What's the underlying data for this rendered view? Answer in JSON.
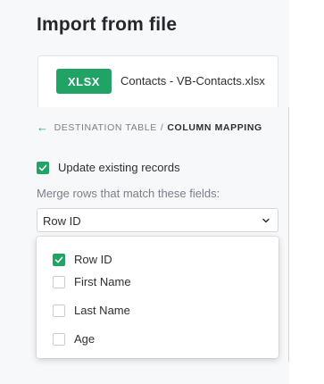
{
  "dialog": {
    "title": "Import from file"
  },
  "file": {
    "badge": "XLSX",
    "name": "Contacts - VB-Contacts.xlsx"
  },
  "breadcrumb": {
    "back_icon": "arrow-left-icon",
    "destination": "DESTINATION TABLE",
    "separator": "/",
    "current": "COLUMN MAPPING"
  },
  "update_existing": {
    "label": "Update existing records",
    "checked": true
  },
  "merge": {
    "label": "Merge rows that match these fields:",
    "selected": "Row ID",
    "options": [
      {
        "label": "Row ID",
        "checked": true
      },
      {
        "label": "First Name",
        "checked": false
      },
      {
        "label": "Last Name",
        "checked": false
      },
      {
        "label": "Age",
        "checked": false
      }
    ]
  },
  "colors": {
    "accent": "#21a366",
    "panel_bg": "#f7f8fa"
  }
}
